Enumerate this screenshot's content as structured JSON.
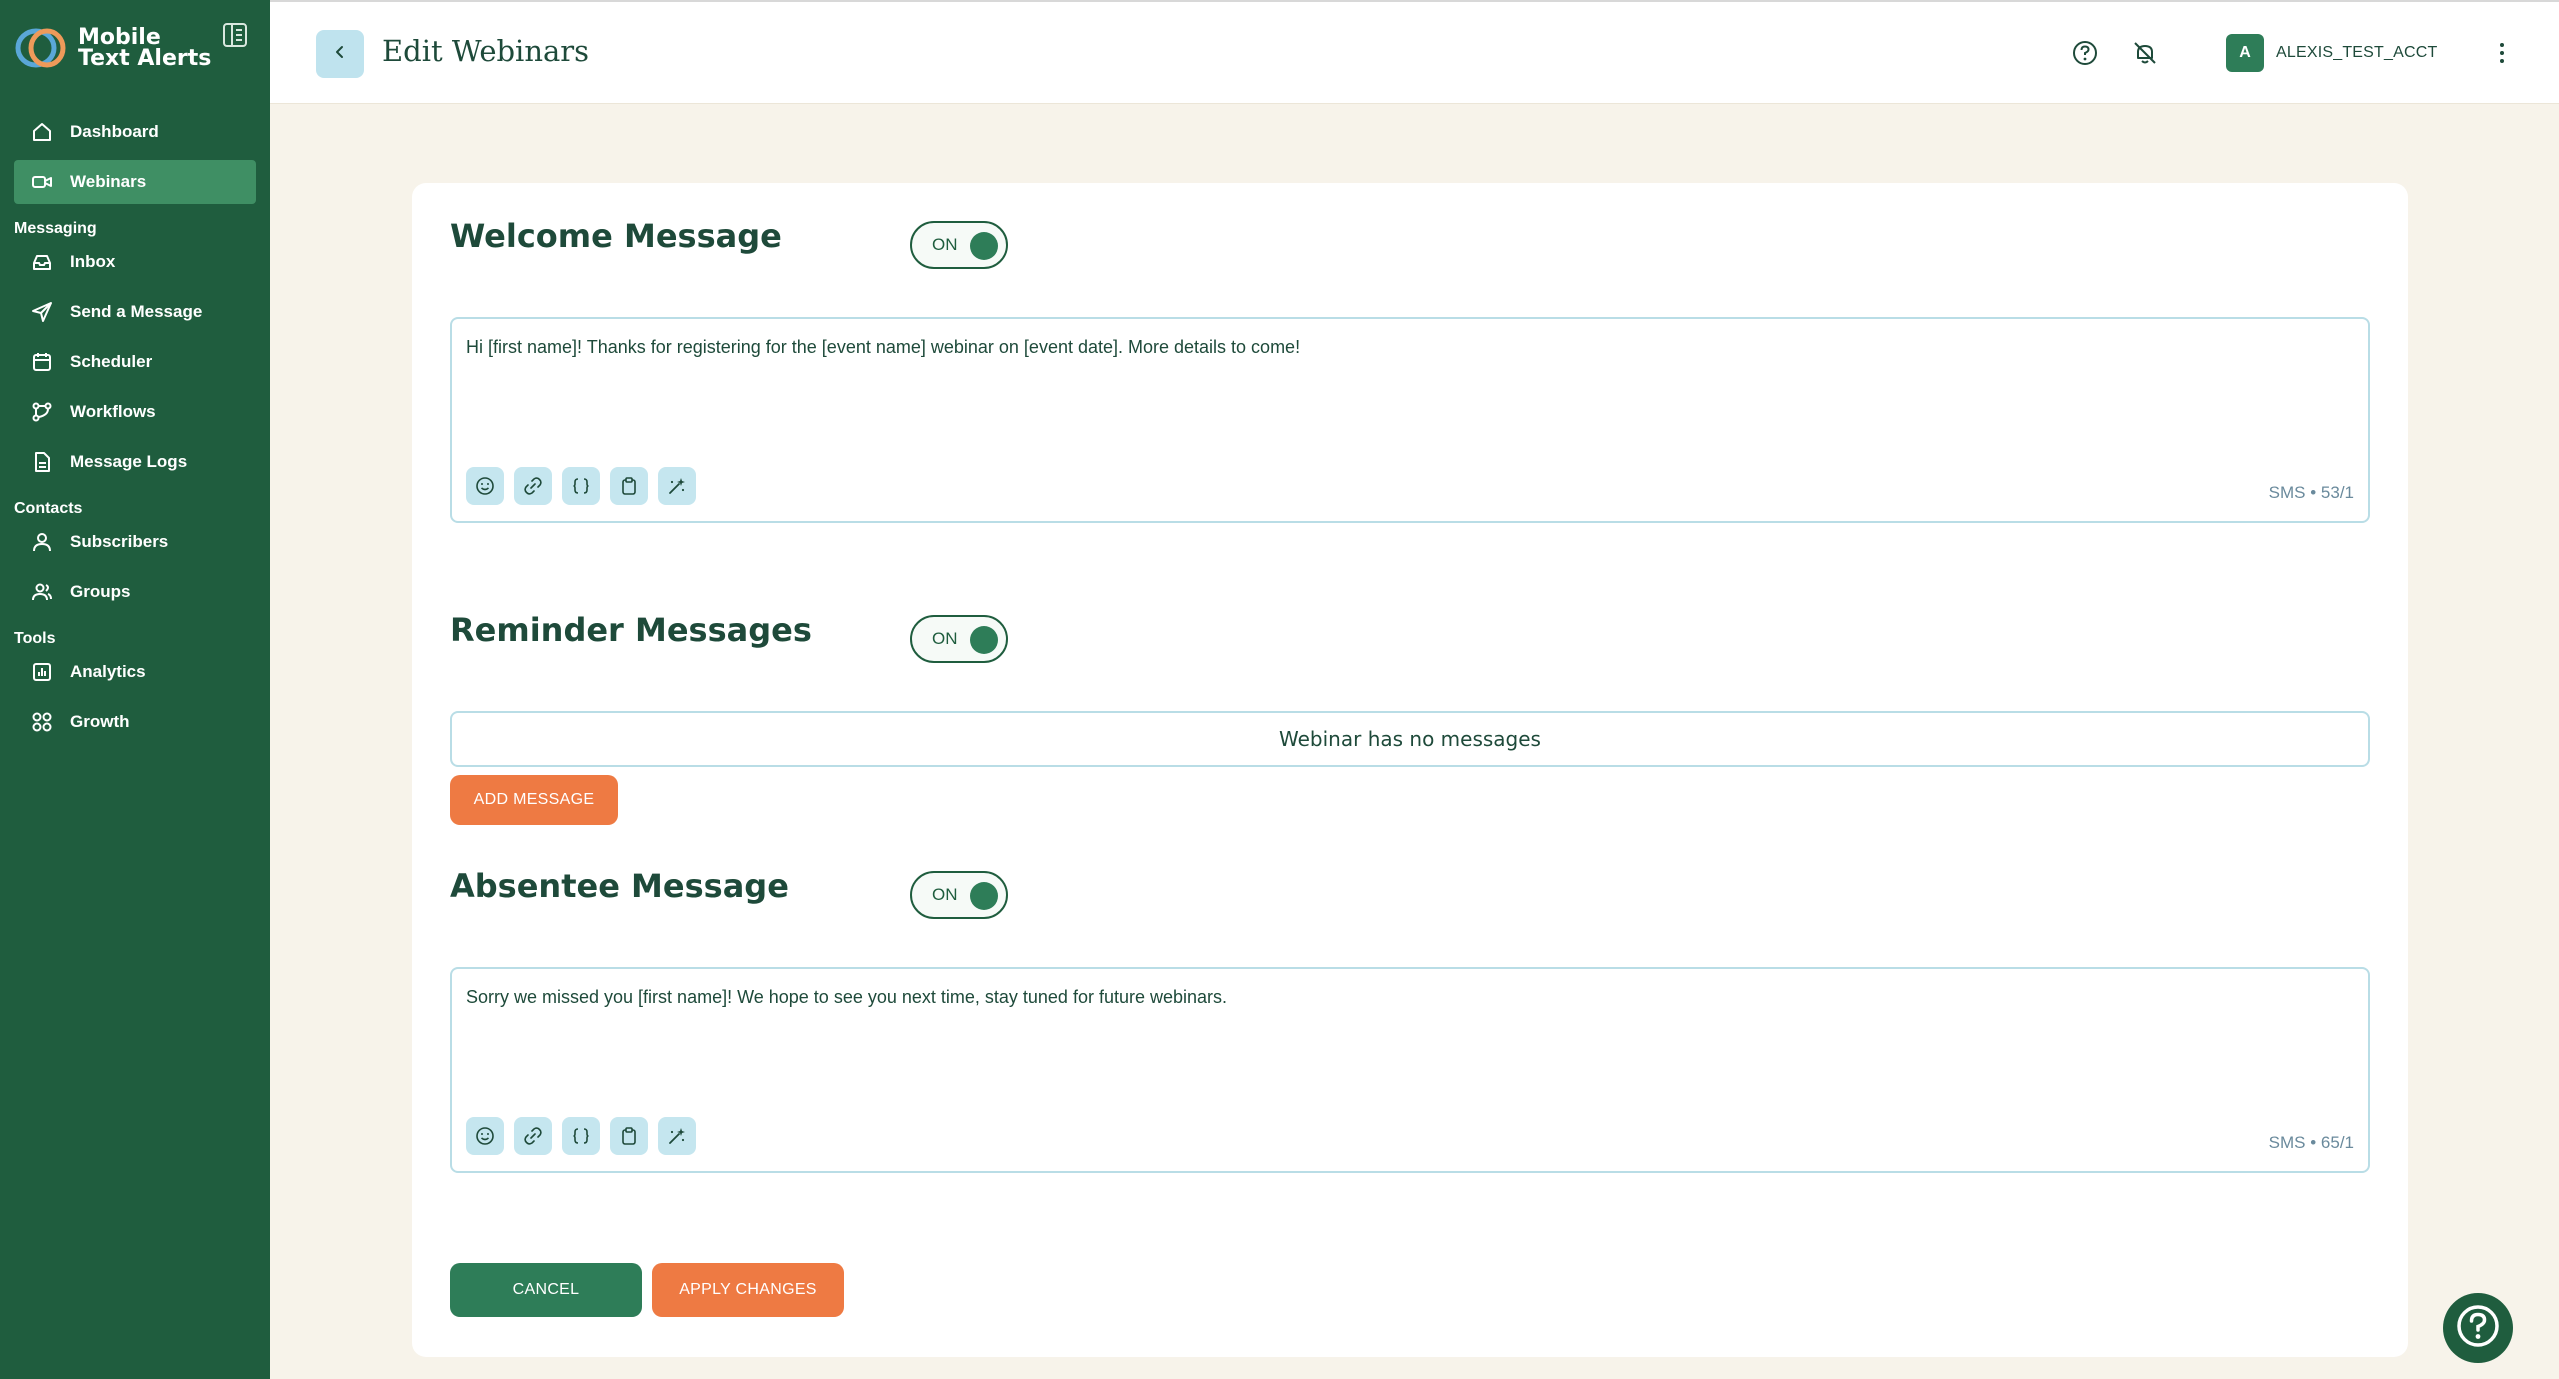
{
  "brand": {
    "line1": "Mobile",
    "line2": "Text Alerts"
  },
  "nav": {
    "dashboard": "Dashboard",
    "webinars": "Webinars",
    "section_messaging": "Messaging",
    "inbox": "Inbox",
    "send": "Send a Message",
    "scheduler": "Scheduler",
    "workflows": "Workflows",
    "logs": "Message Logs",
    "section_contacts": "Contacts",
    "subscribers": "Subscribers",
    "groups": "Groups",
    "section_tools": "Tools",
    "analytics": "Analytics",
    "growth": "Growth"
  },
  "header": {
    "title": "Edit Webinars",
    "avatar_initial": "A",
    "account": "ALEXIS_TEST_ACCT"
  },
  "welcome": {
    "title": "Welcome Message",
    "toggle": "ON",
    "text": "Hi [first name]! Thanks for registering for the [event name] webinar on [event date]. More details to come!",
    "counter": "SMS • 53/1"
  },
  "reminder": {
    "title": "Reminder Messages",
    "toggle": "ON",
    "empty": "Webinar has no messages",
    "add_label": "ADD MESSAGE"
  },
  "absentee": {
    "title": "Absentee Message",
    "toggle": "ON",
    "text": "Sorry we missed you [first name]! We hope to see you next time, stay tuned for future webinars.",
    "counter": "SMS • 65/1"
  },
  "actions": {
    "cancel": "CANCEL",
    "apply": "APPLY CHANGES"
  },
  "colors": {
    "sidebar": "#1f5d3e",
    "active": "#3f8f64",
    "accent_orange": "#ee7a43",
    "accent_green": "#2e7d58",
    "tool_bg": "#c5e6ef"
  }
}
